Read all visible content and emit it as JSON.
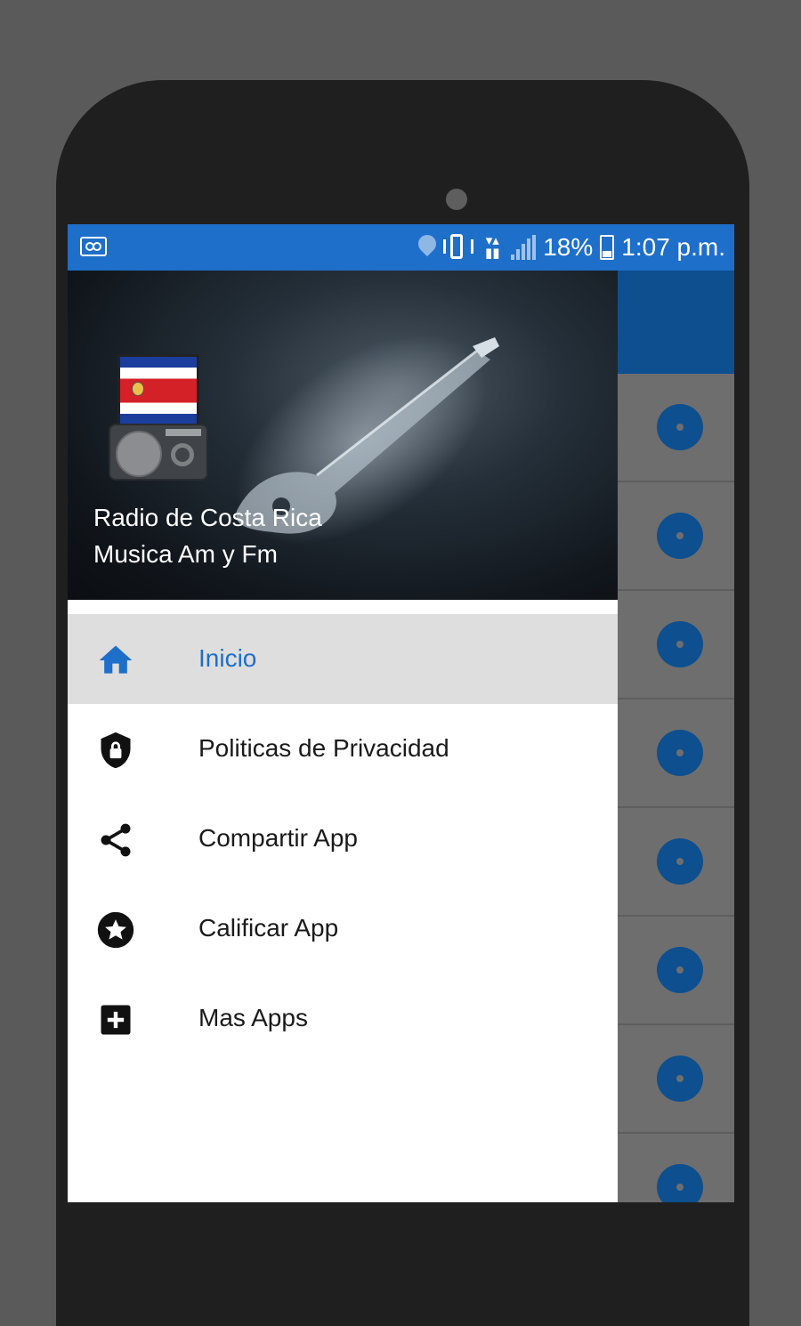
{
  "status_bar": {
    "battery_percent": "18%",
    "time": "1:07 p.m.",
    "icons": [
      "voicemail-icon",
      "location-icon",
      "vibrate-icon",
      "network-icon",
      "signal-icon",
      "battery-icon"
    ]
  },
  "drawer": {
    "header": {
      "title": "Radio de Costa Rica",
      "subtitle": "Musica Am y Fm"
    },
    "items": [
      {
        "label": "Inicio",
        "icon": "home-icon",
        "active": true
      },
      {
        "label": "Politicas de Privacidad",
        "icon": "shield-lock-icon",
        "active": false
      },
      {
        "label": "Compartir App",
        "icon": "share-icon",
        "active": false
      },
      {
        "label": "Calificar App",
        "icon": "star-circle-icon",
        "active": false
      },
      {
        "label": "Mas Apps",
        "icon": "add-box-icon",
        "active": false
      }
    ]
  },
  "colors": {
    "status_bar": "#1e6fc9",
    "app_bar": "#0d4f8f",
    "active_item_bg": "#dedede",
    "active_text": "#1e6fc9"
  }
}
